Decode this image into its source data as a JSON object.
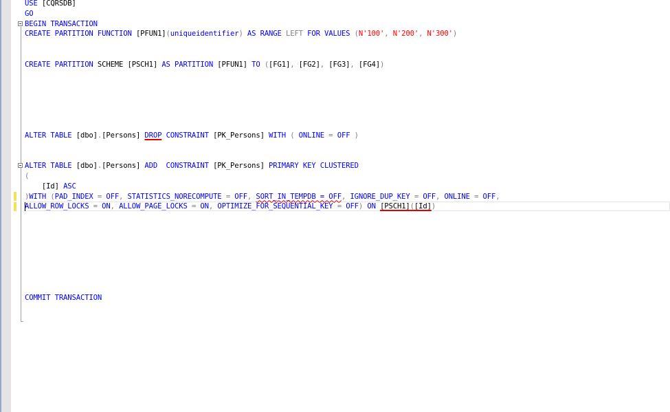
{
  "editor": {
    "language": "T-SQL",
    "lines": {
      "l1": {
        "kw1": "USE ",
        "t1": "[CQRSDB]"
      },
      "l2": {
        "kw1": "GO"
      },
      "l3": {
        "kw1": "BEGIN TRANSACTION"
      },
      "l4": {
        "kw1": "CREATE PARTITION FUNCTION ",
        "t1": "[PFUN1]",
        "p1": "(",
        "kw2": "uniqueidentifier",
        "p2": ") ",
        "kw3": "AS RANGE ",
        "g1": "LEFT ",
        "kw4": "FOR VALUES ",
        "p3": "(",
        "s1": "N'100'",
        "p4": ", ",
        "s2": "N'200'",
        "p5": ", ",
        "s3": "N'300'",
        "p6": ")"
      },
      "l7": {
        "kw1": "CREATE PARTITION ",
        "t0": "SCHEME ",
        "t1": "[PSCH1] ",
        "kw2": "AS PARTITION ",
        "t2": "[PFUN1] ",
        "kw3": "TO ",
        "p1": "(",
        "t3": "[FG1]",
        "p2": ", ",
        "t4": "[FG2]",
        "p3": ", ",
        "t5": "[FG3]",
        "p4": ", ",
        "t6": "[FG4]",
        "p5": ")"
      },
      "l14": {
        "kw1": "ALTER TABLE ",
        "t1": "[dbo]",
        "p1": ".",
        "t2": "[Persons] ",
        "kw2": "DROP",
        "sp": " ",
        "kw3": "CONSTRAINT ",
        "t3": "[PK_Persons] ",
        "kw4": "WITH ",
        "p2": "( ",
        "kw5": "ONLINE ",
        "p3": "= ",
        "kw6": "OFF ",
        "p4": ")"
      },
      "l17": {
        "kw1": "ALTER TABLE ",
        "t1": "[dbo]",
        "p1": ".",
        "t2": "[Persons] ",
        "kw2": "ADD  CONSTRAINT ",
        "t3": "[PK_Persons] ",
        "kw3": "PRIMARY KEY CLUSTERED"
      },
      "l18": {
        "p1": "("
      },
      "l19": {
        "t1": "    [Id] ",
        "kw1": "ASC"
      },
      "l20": {
        "p1": ")",
        "kw1": "WITH ",
        "p2": "(",
        "kw2": "PAD_INDEX ",
        "p3": "= ",
        "kw3": "OFF",
        "p4": ", ",
        "kw4": "STATISTICS_NORECOMPUTE ",
        "p5": "= ",
        "kw5": "OFF",
        "p6": ", ",
        "kw6": "SORT_IN_TEMPDB = OFF",
        "p7": ", ",
        "kw7": "IGNORE_DUP_KEY ",
        "p8": "= ",
        "kw8": "OFF",
        "p9": ", ",
        "kw9": "ONLINE ",
        "p10": "= ",
        "kw10": "OFF",
        "p11": ","
      },
      "l21": {
        "kw1": "ALLOW_ROW_LOCKS ",
        "p1": "= ",
        "kw2": "ON",
        "p2": ", ",
        "kw3": "ALLOW_PAGE_LOCKS ",
        "p3": "= ",
        "kw4": "ON",
        "p4": ", ",
        "kw5": "OPTIMIZE_FOR_SEQUENTIAL_KEY ",
        "p5": "= ",
        "kw6": "OFF",
        "p6": ") ",
        "kw7": "ON ",
        "t1": "[PSCH1]",
        "p7": "(",
        "t2": "[Id]",
        "p8": ")"
      },
      "l30": {
        "kw1": "COMMIT TRANSACTION"
      }
    },
    "colors": {
      "keyword": "#0000ff",
      "operator": "#808080",
      "string": "#ff0000",
      "function": "#ff00ff",
      "error": "#e00000",
      "changed_marker": "#f5e05a"
    }
  }
}
